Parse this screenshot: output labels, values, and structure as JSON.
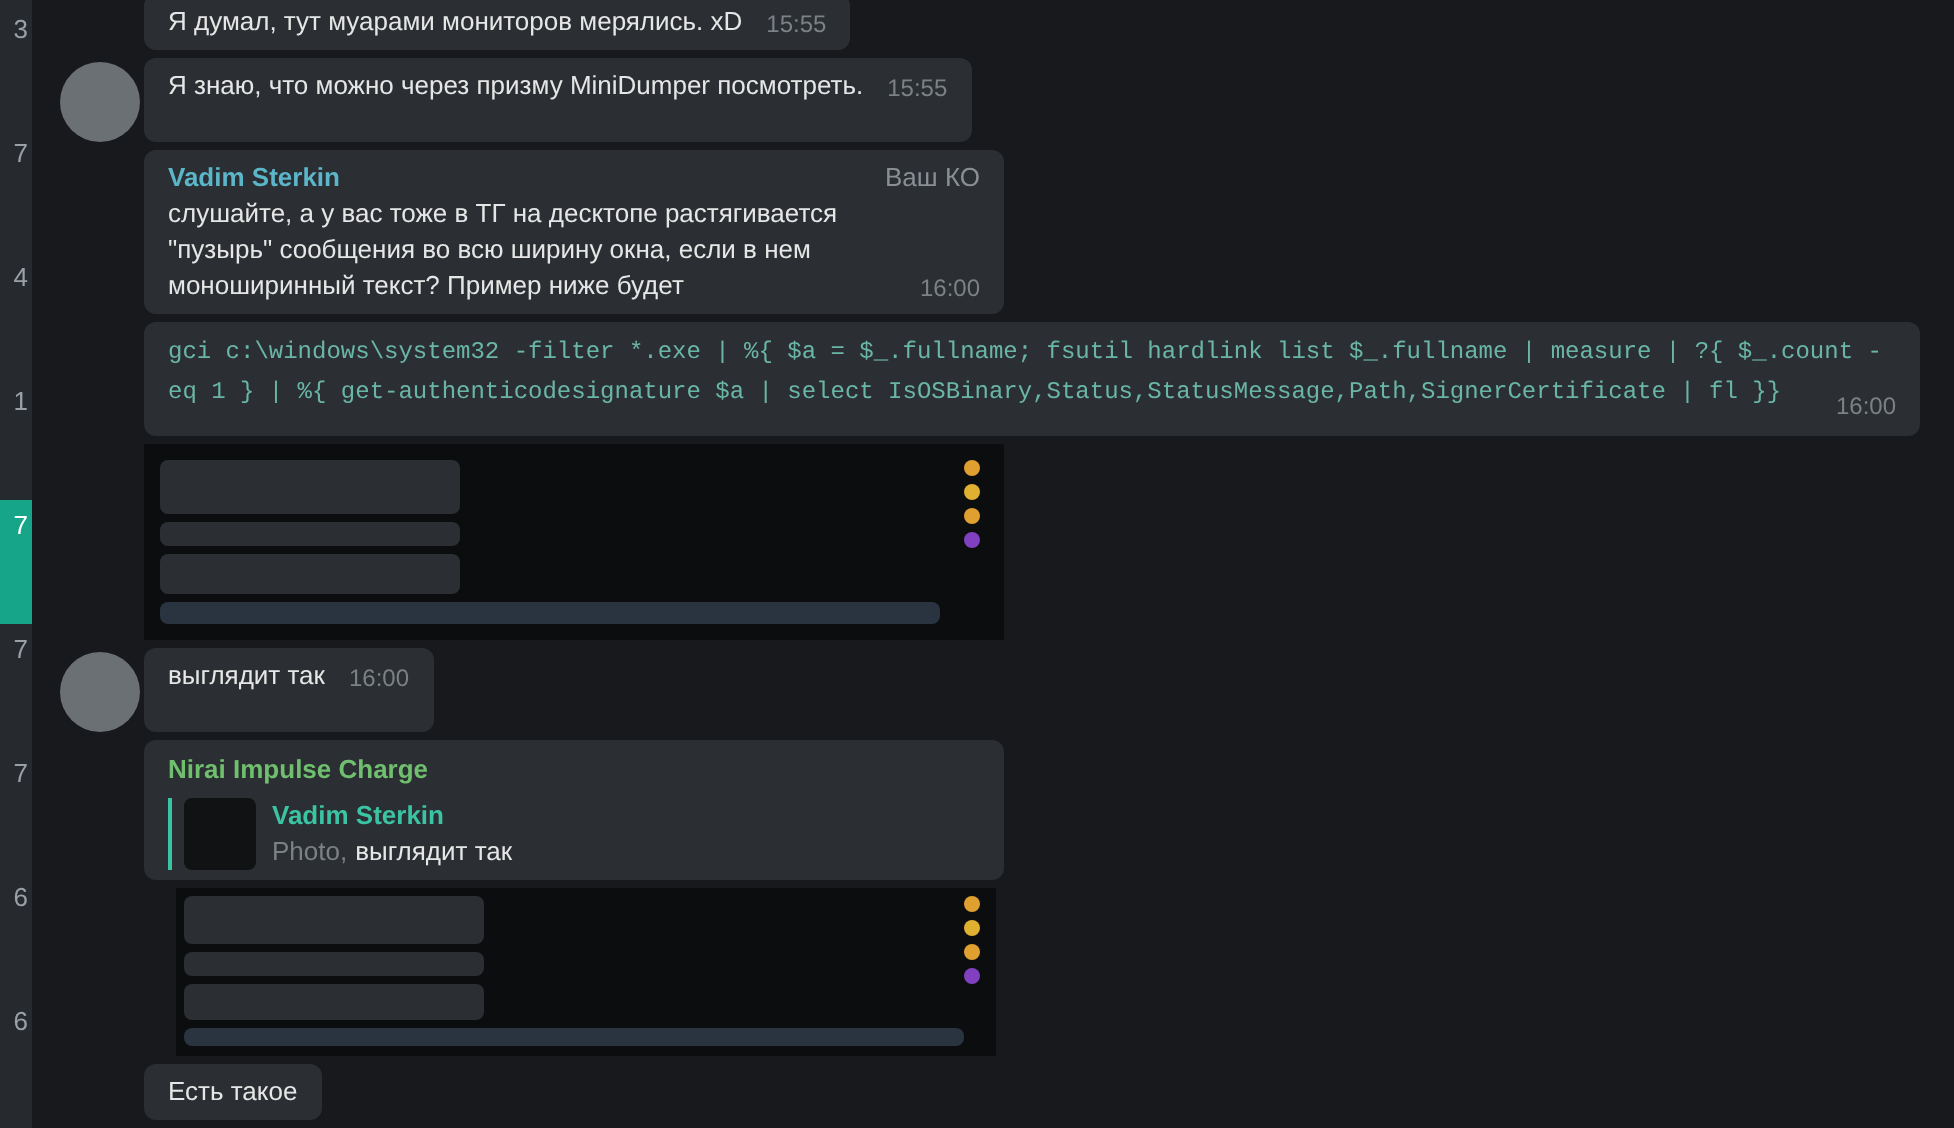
{
  "sidebar": {
    "items": [
      {
        "count": "3",
        "selected": false
      },
      {
        "count": "7",
        "selected": false
      },
      {
        "count": "4",
        "selected": false
      },
      {
        "count": "1",
        "selected": false
      },
      {
        "count": "7",
        "selected": true
      },
      {
        "count": "7",
        "selected": false
      },
      {
        "count": "7",
        "selected": false
      },
      {
        "count": "6",
        "selected": false
      },
      {
        "count": "6",
        "selected": false
      }
    ]
  },
  "messages": [
    {
      "kind": "text",
      "avatar": false,
      "text": "Я думал, тут муарами мониторов мерялись. xD",
      "time": "15:55"
    },
    {
      "kind": "text",
      "avatar": true,
      "text": "Я знаю, что можно через призму MiniDumper посмотреть.",
      "time": "15:55"
    },
    {
      "kind": "text",
      "avatar": false,
      "author": "Vadim Sterkin",
      "badge": "Ваш КО",
      "text": "слушайте, а у вас тоже в ТГ на десктопе растягивается \"пузырь\" сообщения во всю ширину окна, если в нем моноширинный текст? Пример ниже будет",
      "time": "16:00"
    },
    {
      "kind": "code",
      "avatar": false,
      "text": "gci c:\\windows\\system32 -filter *.exe | %{ $a = $_.fullname; fsutil hardlink list $_.fullname | measure | ?{ $_.count -eq 1 } | %{ get-authenticodesignature $a | select IsOSBinary,Status,StatusMessage,Path,SignerCertificate | fl }}",
      "time": "16:00"
    },
    {
      "kind": "image",
      "avatar": false
    },
    {
      "kind": "text",
      "avatar": true,
      "text": "выглядит так",
      "time": "16:00"
    },
    {
      "kind": "reply",
      "avatar": false,
      "author": "Nirai Impulse Charge",
      "reply_author": "Vadim Sterkin",
      "reply_label": "Photo,",
      "reply_text": "выглядит так"
    },
    {
      "kind": "image",
      "avatar": false
    },
    {
      "kind": "text",
      "avatar": false,
      "text": "Есть такое"
    }
  ]
}
